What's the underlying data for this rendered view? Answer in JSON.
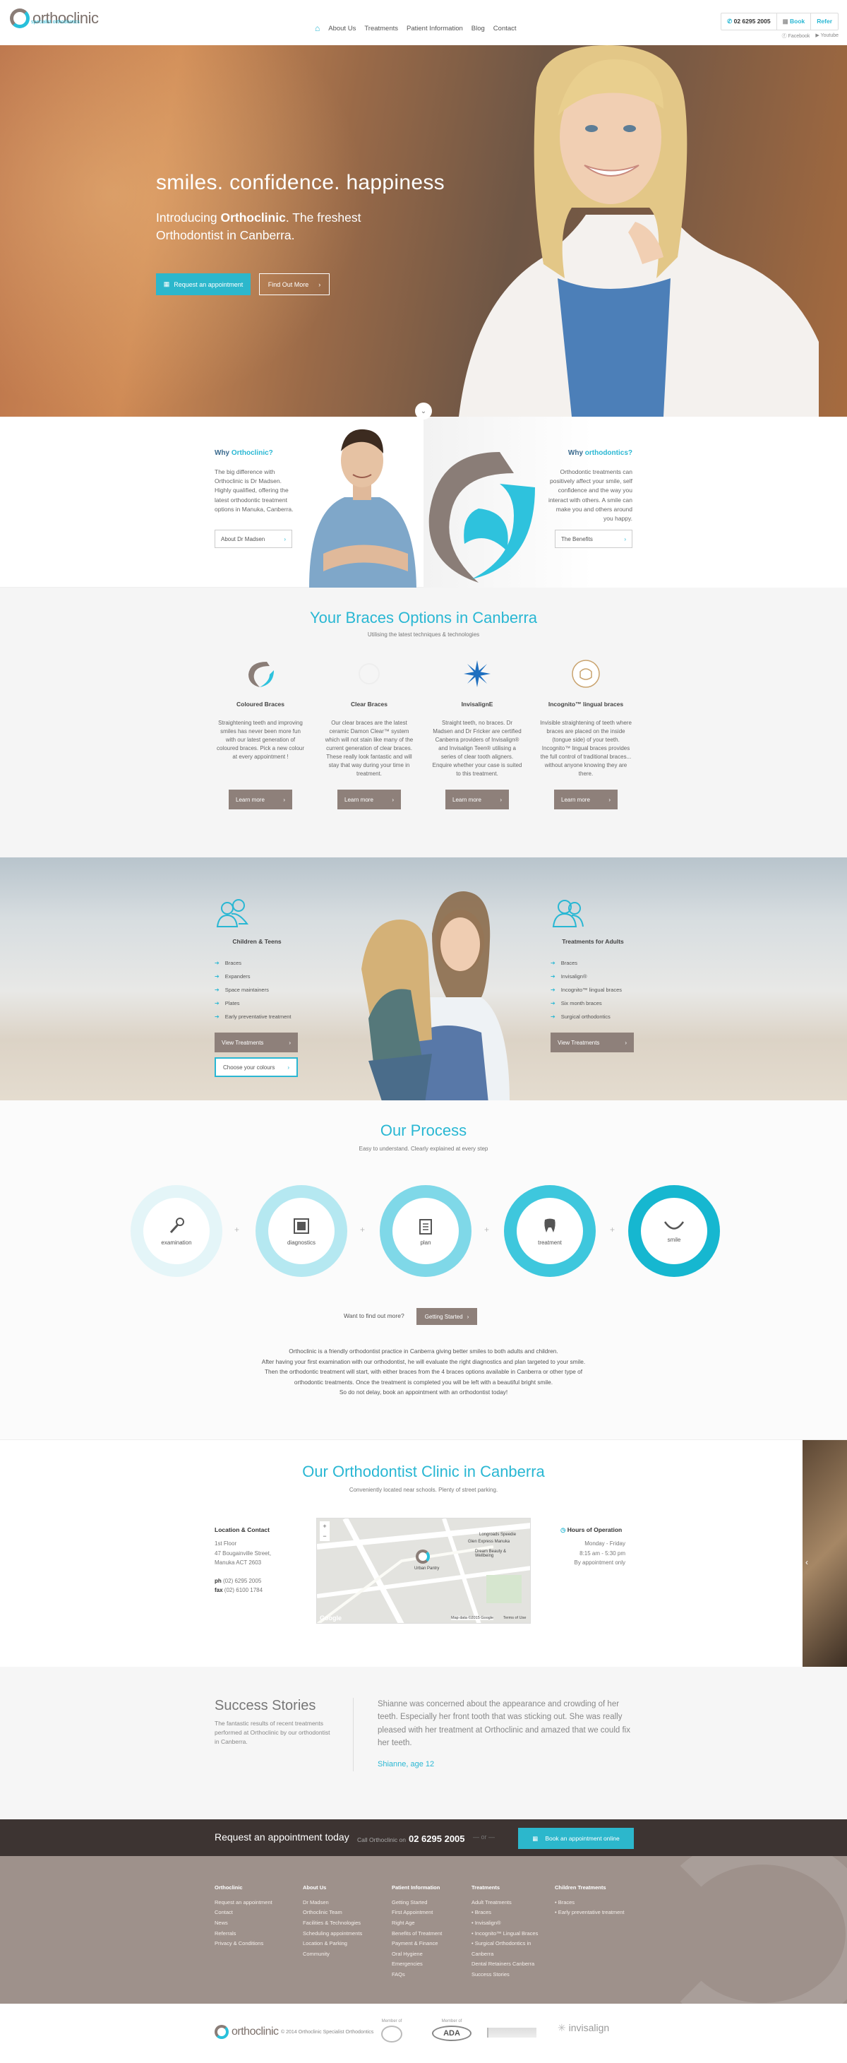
{
  "header": {
    "logo_name": "orthoclinic",
    "logo_tag": "specialist orthodontics",
    "nav": [
      "About Us",
      "Treatments",
      "Patient Information",
      "Blog",
      "Contact"
    ],
    "phone": "02 6295 2005",
    "book": "Book",
    "refer": "Refer",
    "social": [
      "Facebook",
      "Youtube"
    ]
  },
  "hero": {
    "title": "smiles. confidence. happiness",
    "sub_pre": "Introducing ",
    "sub_brand": "Orthoclinic",
    "sub_post": ". The freshest Orthodontist in Canberra.",
    "btn_request": "Request an appointment",
    "btn_more": "Find Out More"
  },
  "why": {
    "left_h_pre": "Why ",
    "left_h_brand": "Orthoclinic?",
    "left_p": "The big difference with Orthoclinic is Dr Madsen. Highly qualified, offering the latest orthodontic treatment options in Manuka, Canberra.",
    "left_btn": "About Dr Madsen",
    "right_h_pre": "Why ",
    "right_h_brand": "orthodontics?",
    "right_p": "Orthodontic treatments can positively affect your smile, self confidence and the way you interact with others. A smile can make you and others around you happy.",
    "right_btn": "The Benefits"
  },
  "braces": {
    "title": "Your Braces Options in Canberra",
    "sub": "Utilising the latest techniques & technologies",
    "options": [
      {
        "h": "Coloured Braces",
        "p": "Straightening teeth and improving smiles has never been more fun with our latest generation of coloured braces. Pick a new colour at every appointment !",
        "btn": "Learn more"
      },
      {
        "h": "Clear Braces",
        "p": "Our clear braces are the latest ceramic Damon Clear™ system which will not stain like many of the current generation of clear braces. These really look fantastic and will stay that way during your time in treatment.",
        "btn": "Learn more"
      },
      {
        "h": "InvisalignE",
        "p": "Straight teeth, no braces. Dr Madsen and Dr Fricker are certified Canberra providers of Invisalign® and Invisalign Teen® utilising a series of clear tooth aligners. Enquire whether your case is suited to this treatment.",
        "btn": "Learn more"
      },
      {
        "h": "Incognito™ lingual braces",
        "p": "Invisible straightening of teeth where braces are placed on the inside (tongue side) of your teeth. Incognito™ lingual braces provides the full control of traditional braces... without anyone knowing they are there.",
        "btn": "Learn more"
      }
    ]
  },
  "treatments": {
    "left_h": "Children & Teens",
    "left_items": [
      "Braces",
      "Expanders",
      "Space maintainers",
      "Plates",
      "Early preventative treatment"
    ],
    "left_btn": "View Treatments",
    "left_btn2": "Choose your colours",
    "right_h": "Treatments for Adults",
    "right_items": [
      "Braces",
      "Invisalign®",
      "Incognito™ lingual braces",
      "Six month braces",
      "Surgical orthodontics"
    ],
    "right_btn": "View Treatments"
  },
  "process": {
    "title": "Our Process",
    "sub": "Easy to understand. Clearly explained at every step",
    "steps": [
      "examination",
      "diagnostics",
      "plan",
      "treatment",
      "smile"
    ],
    "findout": "Want to find out more?",
    "btn": "Getting Started",
    "para": [
      "Orthoclinic is a friendly orthodontist practice in Canberra giving better smiles to both adults and children.",
      "After having your first examination with our orthodontist, he will evaluate the right diagnostics and plan targeted to your smile.",
      "Then the orthodontic treatment will start, with either braces from the 4 braces options available in Canberra or other type of",
      "orthodontic treatments. Once the treatment is completed you will be left with a beautiful bright smile.",
      "So do not delay, book an appointment with an orthodontist today!"
    ]
  },
  "clinic": {
    "title": "Our Orthodontist Clinic in Canberra",
    "sub": "Conveniently located near schools. Plenty of street parking.",
    "loc_h": "Location & Contact",
    "addr1": "1st Floor",
    "addr2": "47 Bougainville Street,",
    "addr3": "Manuka ACT 2603",
    "ph_label": "ph",
    "ph": "(02) 6295 2005",
    "fax_label": "fax",
    "fax": "(02) 6100 1784",
    "hours_h": "Hours of Operation",
    "hours1": "Monday - Friday",
    "hours2": "8:15 am - 5:30 pm",
    "hours3": "By appointment only",
    "map_labels": [
      "Longroads Speedie",
      "Glen Express Manuka",
      "Dream Beauty & Wellbeing",
      "Urban Pantry",
      "Map data ©2015 Google",
      "Terms of Use",
      "Google"
    ]
  },
  "stories": {
    "h": "Success Stories",
    "p": "The fantastic results of recent treatments performed at Orthoclinic by our orthodontist in Canberra.",
    "quote": "Shianne was concerned about the appearance and crowding of her teeth. Especially her front tooth that was sticking out. She was really pleased with her treatment at Orthoclinic and amazed that we could fix her teeth.",
    "name": "Shianne, age 12"
  },
  "request": {
    "h": "Request an appointment today",
    "call": "Call Orthoclinic on",
    "phone": "02 6295 2005",
    "or": "or",
    "btn": "Book an appointment online"
  },
  "footer": {
    "cols": [
      {
        "h": "Orthoclinic",
        "items": [
          "Request an appointment",
          "Contact",
          "News",
          "Referrals",
          "Privacy & Conditions"
        ]
      },
      {
        "h": "About Us",
        "items": [
          "Dr Madsen",
          "Orthoclinic Team",
          "Facilities & Technologies",
          "Scheduling appointments",
          "Location & Parking",
          "Community"
        ]
      },
      {
        "h": "Patient Information",
        "items": [
          "Getting Started",
          "First Appointment",
          "Right Age",
          "Benefits of Treatment",
          "Payment & Finance",
          "Oral Hygiene",
          "Emergencies",
          "FAQs"
        ]
      },
      {
        "h": "Treatments",
        "items": [
          "Adult Treatments",
          "Braces",
          "Invisalign®",
          "Incognito™ Lingual Braces",
          "Surgical Orthodontics in Canberra",
          "Dental Retainers Canberra",
          "Success Stories"
        ]
      },
      {
        "h": "Children Treatments",
        "items": [
          "Braces",
          "Early preventative treatment"
        ]
      }
    ]
  },
  "bottom": {
    "logo_name": "orthoclinic",
    "copy": "© 2014 Orthoclinic Specialist Orthodontics",
    "members": [
      "Member of",
      "Member of",
      "ADA",
      "invisalign"
    ]
  },
  "colors": {
    "accent": "#29b7d3",
    "brown": "#8e807a",
    "dark": "#3d3432",
    "footer": "#9e918b"
  }
}
